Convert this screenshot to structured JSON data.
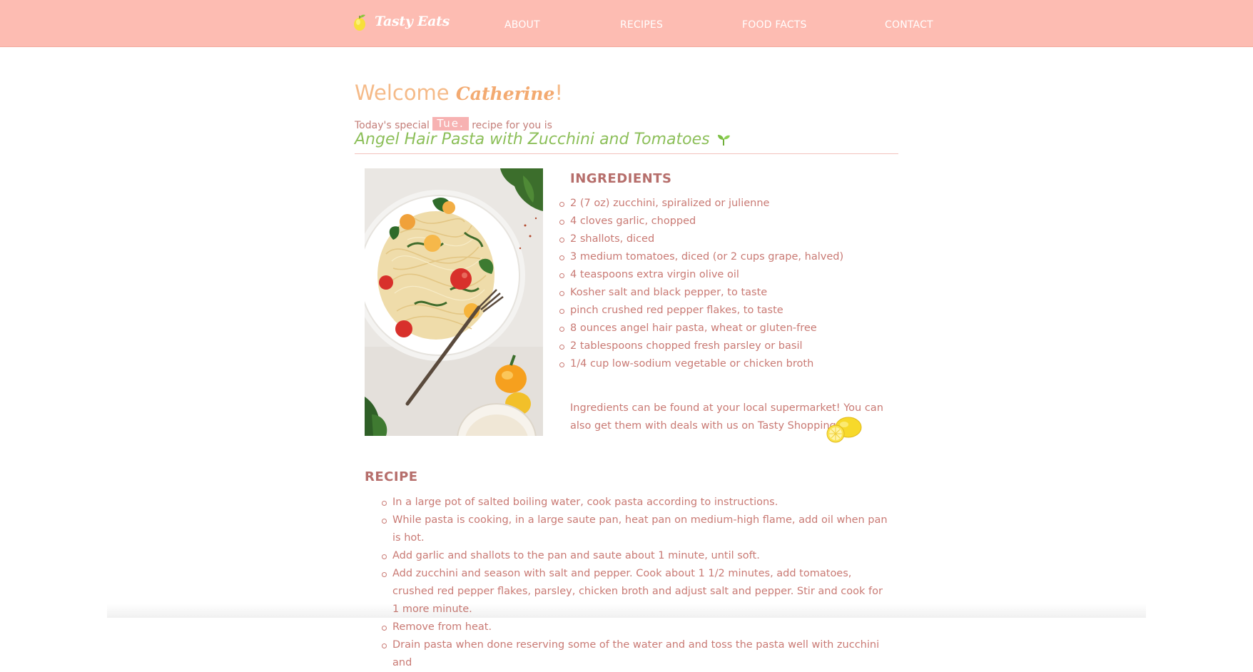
{
  "brand": {
    "name": "Tasty Eats",
    "icon": "lemon-icon"
  },
  "nav": [
    {
      "label": "ABOUT"
    },
    {
      "label": "RECIPES"
    },
    {
      "label": "FOOD FACTS"
    },
    {
      "label": "CONTACT"
    }
  ],
  "welcome": {
    "greeting": "Welcome",
    "name": "Catherine",
    "punct": "!"
  },
  "special": {
    "prefix": "Today's special",
    "day": "Tue.",
    "suffix": "recipe for you is"
  },
  "recipe": {
    "title": "Angel Hair Pasta with Zucchini and Tomatoes",
    "title_icon": "sprout-icon",
    "photo": "pasta-dish-photo"
  },
  "ingredients": {
    "heading": "INGREDIENTS",
    "items": [
      "2 (7 oz) zucchini, spiralized or julienne",
      "4 cloves garlic, chopped",
      "2 shallots, diced",
      "3 medium tomatoes, diced (or 2 cups grape, halved)",
      "4 teaspoons extra virgin olive oil",
      "Kosher salt and black pepper, to taste",
      "pinch crushed red pepper flakes, to taste",
      "8 ounces angel hair pasta, wheat or gluten-free",
      "2 tablespoons chopped fresh parsley or basil",
      "1/4 cup low-sodium vegetable or chicken broth"
    ],
    "note": "Ingredients can be found at your local supermarket! You can also get them with deals with us on Tasty Shopping."
  },
  "steps": {
    "heading": "RECIPE",
    "items": [
      "In a large pot of salted boiling water, cook pasta according to instructions.",
      "While pasta is cooking, in a large saute pan, heat pan on medium-high flame, add oil when pan is hot.",
      "Add garlic and shallots to the pan and saute about 1 minute, until soft.",
      "Add zucchini and season with salt and pepper. Cook about 1 1/2 minutes, add tomatoes, crushed red pepper flakes, parsley, chicken broth and adjust salt and pepper. Stir and cook for 1 more minute.",
      "Remove from heat.",
      "Drain pasta when done reserving some of the water and and toss the pasta well with zucchini and"
    ]
  },
  "colors": {
    "header_bg": "#fdbcb2",
    "welcome": "#f5ba88",
    "title_green": "#8cbf59",
    "heading": "#b66e6b",
    "body_text": "#c97a74"
  }
}
